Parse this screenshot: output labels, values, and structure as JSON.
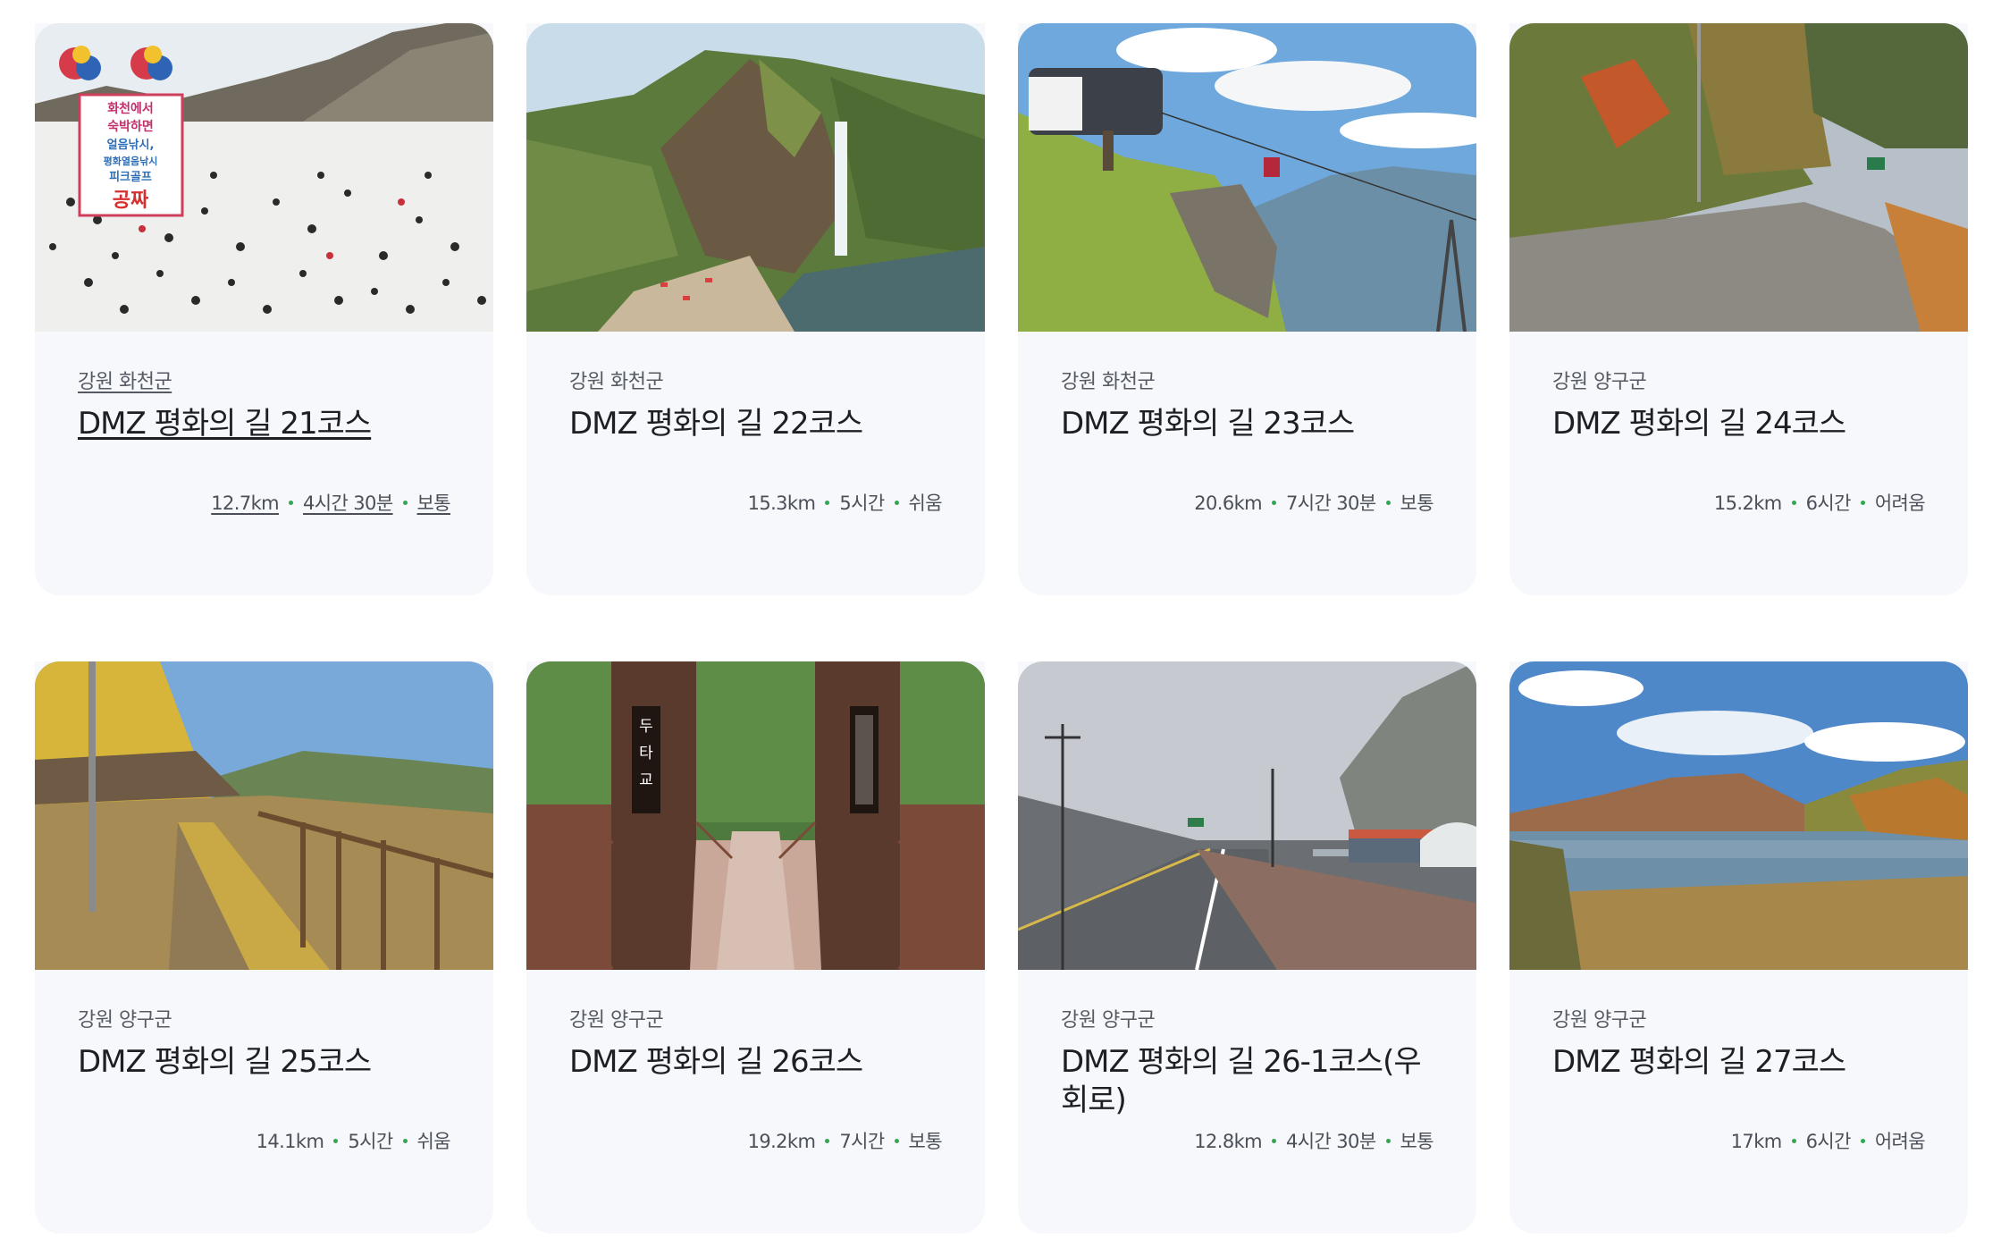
{
  "cards": [
    {
      "region": "강원 화천군",
      "title": "DMZ 평화의 길 21코스",
      "distance": "12.7km",
      "duration": "4시간 30분",
      "difficulty": "보통",
      "image": "ice-fishing-festival"
    },
    {
      "region": "강원 화천군",
      "title": "DMZ 평화의 길 22코스",
      "distance": "15.3km",
      "duration": "5시간",
      "difficulty": "쉬움",
      "image": "waterfall-cliff"
    },
    {
      "region": "강원 화천군",
      "title": "DMZ 평화의 길 23코스",
      "distance": "20.6km",
      "duration": "7시간 30분",
      "difficulty": "보통",
      "image": "cable-car-mountain"
    },
    {
      "region": "강원 양구군",
      "title": "DMZ 평화의 길 24코스",
      "distance": "15.2km",
      "duration": "6시간",
      "difficulty": "어려움",
      "image": "autumn-road"
    },
    {
      "region": "강원 양구군",
      "title": "DMZ 평화의 길 25코스",
      "distance": "14.1km",
      "duration": "5시간",
      "difficulty": "쉬움",
      "image": "wooden-boardwalk"
    },
    {
      "region": "강원 양구군",
      "title": "DMZ 평화의 길 26코스",
      "distance": "19.2km",
      "duration": "7시간",
      "difficulty": "보통",
      "image": "suspension-bridge",
      "sign_left": "두타교"
    },
    {
      "region": "강원 양구군",
      "title": "DMZ 평화의 길 26-1코스(우회로)",
      "distance": "12.8km",
      "duration": "4시간 30분",
      "difficulty": "보통",
      "image": "foggy-road"
    },
    {
      "region": "강원 양구군",
      "title": "DMZ 평화의 길 27코스",
      "distance": "17km",
      "duration": "6시간",
      "difficulty": "어려움",
      "image": "lake-autumn"
    }
  ],
  "thumb_text": {
    "banner_lines": [
      "화천에서",
      "숙박하면",
      "얼음낚시,",
      "평화열음낚시",
      "피크골프",
      "공짜"
    ]
  },
  "colors": {
    "card_bg": "#f6f8fc",
    "dot": "#2fa84f",
    "title": "#1d1f24",
    "meta": "#4b4f57"
  }
}
